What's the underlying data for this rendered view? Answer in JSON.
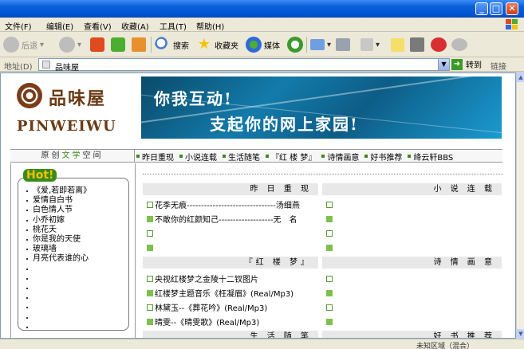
{
  "menu": [
    "文件(F)",
    "编辑(E)",
    "查看(V)",
    "收藏(A)",
    "工具(T)",
    "帮助(H)"
  ],
  "toolbar": {
    "back": "后退",
    "search": "搜索",
    "favorites": "收藏夹",
    "media": "媒体"
  },
  "address": {
    "label": "地址(D)",
    "value": "品味屋",
    "go": "转到",
    "links": "链接"
  },
  "site": {
    "logo_cn": "品味屋",
    "logo_en": "PINWEIWU",
    "banner_line1": "你我互动!",
    "banner_line2": "支起你的网上家园!"
  },
  "nav": {
    "left": [
      "原",
      "创",
      "文",
      "学",
      "空",
      "间"
    ],
    "items": [
      "昨日重现",
      "小说连载",
      "生活随笔",
      "『红 楼 梦』",
      "诗情画意",
      "好书推荐",
      "绛云轩BBS"
    ]
  },
  "hot": {
    "title": "Hot!",
    "items": [
      "《爱,若即若离》",
      "爱情自白书",
      "白色情人节",
      "小乔初嫁",
      "桃花夭",
      "你是我的天使",
      "玻璃墙",
      "月亮代表谁的心",
      "",
      "",
      "",
      "",
      "",
      "",
      ""
    ]
  },
  "panels": {
    "p1": {
      "title": "昨 日 重 现",
      "rows": [
        {
          "marker": "empty",
          "text": "花季无痕-------------------------------汤细燕"
        },
        {
          "marker": "fill",
          "text": "不敢你的红颜知己-------------------无　名"
        },
        {
          "marker": "empty",
          "text": ""
        },
        {
          "marker": "fill",
          "text": ""
        }
      ]
    },
    "p2": {
      "title": "小 说 连 载",
      "rows": [
        {
          "marker": "empty",
          "text": ""
        },
        {
          "marker": "fill",
          "text": ""
        },
        {
          "marker": "empty",
          "text": ""
        },
        {
          "marker": "fill",
          "text": ""
        }
      ]
    },
    "p3": {
      "title": "『红 楼 梦』",
      "rows": [
        {
          "marker": "empty",
          "text": "央视红楼梦之金陵十二钗图片"
        },
        {
          "marker": "fill",
          "text": "红楼梦主题音乐《枉凝眉》(Real/Mp3)"
        },
        {
          "marker": "empty",
          "text": "林黛玉--《葬花吟》(Real/Mp3)"
        },
        {
          "marker": "fill",
          "text": "晴雯--《晴雯歌》(Real/Mp3)"
        }
      ]
    },
    "p4": {
      "title": "诗 情 画 意",
      "rows": [
        {
          "marker": "empty",
          "text": ""
        },
        {
          "marker": "fill",
          "text": ""
        },
        {
          "marker": "empty",
          "text": ""
        },
        {
          "marker": "fill",
          "text": ""
        }
      ]
    },
    "p5": {
      "title": "生 活 随 笔"
    },
    "p6": {
      "title": "好 书 推 荐"
    }
  },
  "status": {
    "zone": "未知区域（混合）"
  },
  "colors": {
    "accent_green": "#3b8a1c",
    "brand_brown": "#6a3a14",
    "banner_blue": "#137bab"
  }
}
